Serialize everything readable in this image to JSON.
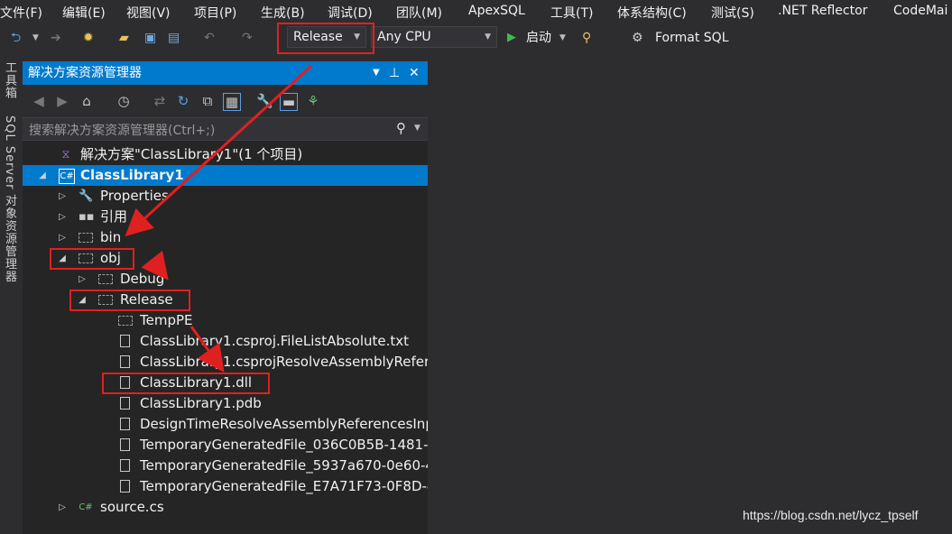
{
  "menu": [
    "文件(F)",
    "编辑(E)",
    "视图(V)",
    "项目(P)",
    "生成(B)",
    "调试(D)",
    "团队(M)",
    "ApexSQL",
    "工具(T)",
    "体系结构(C)",
    "测试(S)",
    ".NET Reflector",
    "CodeMai"
  ],
  "toolbar": {
    "configuration": "Release",
    "platform": "Any CPU",
    "start_label": "启动",
    "format_sql_label": "Format SQL"
  },
  "side_tabs": [
    "工具箱",
    "SQL Server 对象资源管理器"
  ],
  "solution_explorer": {
    "title": "解决方案资源管理器",
    "search_placeholder": "搜索解决方案资源管理器(Ctrl+;)",
    "tree": [
      {
        "label": "解决方案\"ClassLibrary1\"(1 个项目)",
        "icon": "solution-icon",
        "level": 0,
        "expander": ""
      },
      {
        "label": "ClassLibrary1",
        "icon": "csharp-project-icon",
        "level": 0,
        "expander": "expanded",
        "selected": true,
        "bold": true
      },
      {
        "label": "Properties",
        "icon": "wrench-icon",
        "level": 1,
        "expander": "collapsed"
      },
      {
        "label": "引用",
        "icon": "references-icon",
        "level": 1,
        "expander": "collapsed"
      },
      {
        "label": "bin",
        "icon": "folder-icon",
        "level": 1,
        "expander": "collapsed"
      },
      {
        "label": "obj",
        "icon": "folder-open-icon",
        "level": 1,
        "expander": "expanded",
        "highlight": true
      },
      {
        "label": "Debug",
        "icon": "folder-icon",
        "level": 2,
        "expander": "collapsed"
      },
      {
        "label": "Release",
        "icon": "folder-open-icon",
        "level": 2,
        "expander": "expanded",
        "highlight": true
      },
      {
        "label": "TempPE",
        "icon": "folder-icon",
        "level": 3,
        "expander": ""
      },
      {
        "label": "ClassLibrary1.csproj.FileListAbsolute.txt",
        "icon": "file-icon",
        "level": 3,
        "expander": ""
      },
      {
        "label": "ClassLibrary1.csprojResolveAssemblyRefere",
        "icon": "file-icon",
        "level": 3,
        "expander": ""
      },
      {
        "label": "ClassLibrary1.dll",
        "icon": "file-icon",
        "level": 3,
        "expander": "",
        "highlight": true
      },
      {
        "label": "ClassLibrary1.pdb",
        "icon": "file-icon",
        "level": 3,
        "expander": ""
      },
      {
        "label": "DesignTimeResolveAssemblyReferencesInp",
        "icon": "file-icon",
        "level": 3,
        "expander": ""
      },
      {
        "label": "TemporaryGeneratedFile_036C0B5B-1481-4",
        "icon": "file-icon",
        "level": 3,
        "expander": ""
      },
      {
        "label": "TemporaryGeneratedFile_5937a670-0e60-4",
        "icon": "file-icon",
        "level": 3,
        "expander": ""
      },
      {
        "label": "TemporaryGeneratedFile_E7A71F73-0F8D-4",
        "icon": "file-icon",
        "level": 3,
        "expander": ""
      },
      {
        "label": "source.cs",
        "icon": "csharp-file-icon",
        "level": 1,
        "expander": "collapsed"
      }
    ]
  },
  "watermark": "https://blog.csdn.net/lycz_tpself",
  "colors": {
    "accent": "#007acc",
    "annotation": "#e02020",
    "background": "#2d2d30",
    "panel": "#252526"
  }
}
